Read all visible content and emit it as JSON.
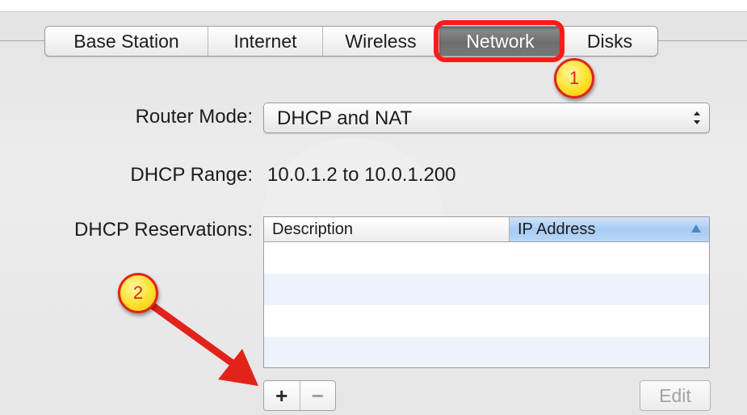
{
  "tabs": [
    {
      "label": "Base Station",
      "selected": false
    },
    {
      "label": "Internet",
      "selected": false
    },
    {
      "label": "Wireless",
      "selected": false
    },
    {
      "label": "Network",
      "selected": true
    },
    {
      "label": "Disks",
      "selected": false
    }
  ],
  "callouts": {
    "one": "1",
    "two": "2"
  },
  "router_mode": {
    "label": "Router Mode:",
    "value": "DHCP and NAT"
  },
  "dhcp_range": {
    "label": "DHCP Range:",
    "value": "10.0.1.2 to 10.0.1.200"
  },
  "reservations": {
    "label": "DHCP Reservations:",
    "columns": [
      "Description",
      "IP Address"
    ],
    "rows": []
  },
  "buttons": {
    "add": "+",
    "remove": "−",
    "edit": "Edit"
  },
  "colors": {
    "highlight": "#ff1a1a",
    "callout_fill": "#ffe02b",
    "arrow": "#e2231a",
    "selected_tab": "#7a7a7a",
    "sort_header": "#a7ccf3"
  }
}
